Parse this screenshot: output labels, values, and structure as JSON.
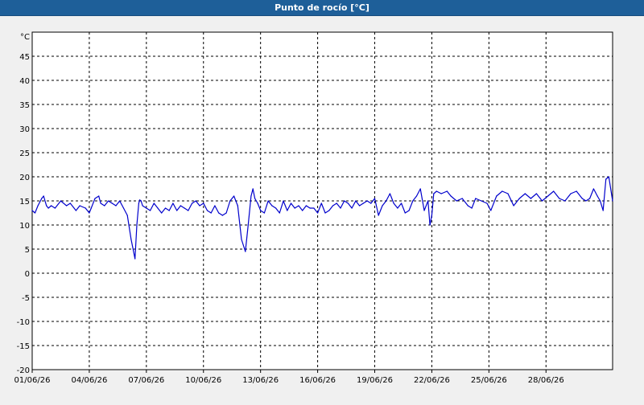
{
  "window": {
    "title": "Punto de rocío [°C]"
  },
  "colors": {
    "titlebar": "#1e5f99",
    "background": "#f0f0f0",
    "plot_background": "#ffffff",
    "series_line": "#0000cc",
    "grid": "#000000"
  },
  "chart_data": {
    "type": "line",
    "title": "Punto de rocío [°C]",
    "ylabel": "°C",
    "xlabel": "",
    "ylim": [
      -20,
      50
    ],
    "yticks": [
      -20,
      -15,
      -10,
      -5,
      0,
      5,
      10,
      15,
      20,
      25,
      30,
      35,
      40,
      45
    ],
    "xlim": [
      0,
      30.5
    ],
    "xticks": [
      {
        "day": 0,
        "label": "01/06/26"
      },
      {
        "day": 3,
        "label": "04/06/26"
      },
      {
        "day": 6,
        "label": "07/06/26"
      },
      {
        "day": 9,
        "label": "10/06/26"
      },
      {
        "day": 12,
        "label": "13/06/26"
      },
      {
        "day": 15,
        "label": "16/06/26"
      },
      {
        "day": 18,
        "label": "19/06/26"
      },
      {
        "day": 21,
        "label": "22/06/26"
      },
      {
        "day": 24,
        "label": "25/06/26"
      },
      {
        "day": 27,
        "label": "28/06/26"
      }
    ],
    "grid": true,
    "legend": "none",
    "series": [
      {
        "name": "",
        "x": [
          0.0,
          0.15,
          0.3,
          0.5,
          0.6,
          0.75,
          0.85,
          1.0,
          1.2,
          1.5,
          1.8,
          2.0,
          2.3,
          2.5,
          2.8,
          3.0,
          3.1,
          3.3,
          3.5,
          3.6,
          3.8,
          4.0,
          4.2,
          4.4,
          4.6,
          4.8,
          5.0,
          5.2,
          5.4,
          5.5,
          5.6,
          5.65,
          5.72,
          5.8,
          6.0,
          6.2,
          6.4,
          6.6,
          6.8,
          7.0,
          7.2,
          7.4,
          7.6,
          7.8,
          8.0,
          8.2,
          8.4,
          8.6,
          8.8,
          9.0,
          9.2,
          9.4,
          9.6,
          9.8,
          10.0,
          10.2,
          10.4,
          10.6,
          10.8,
          11.0,
          11.2,
          11.35,
          11.5,
          11.6,
          11.7,
          11.85,
          12.0,
          12.2,
          12.4,
          12.6,
          12.8,
          13.0,
          13.2,
          13.4,
          13.6,
          13.8,
          14.0,
          14.2,
          14.4,
          14.6,
          14.8,
          15.0,
          15.2,
          15.4,
          15.6,
          15.8,
          16.0,
          16.2,
          16.4,
          16.6,
          16.8,
          17.0,
          17.2,
          17.4,
          17.6,
          17.8,
          18.0,
          18.2,
          18.4,
          18.6,
          18.8,
          19.0,
          19.2,
          19.4,
          19.6,
          19.8,
          20.0,
          20.2,
          20.4,
          20.6,
          20.8,
          20.9,
          21.0,
          21.1,
          21.25,
          21.5,
          21.8,
          22.0,
          22.3,
          22.6,
          22.9,
          23.1,
          23.3,
          23.6,
          23.9,
          24.1,
          24.4,
          24.7,
          25.0,
          25.3,
          25.6,
          25.9,
          26.2,
          26.5,
          26.8,
          27.1,
          27.4,
          27.7,
          28.0,
          28.3
        ],
        "values": [
          13,
          12.5,
          14,
          15.5,
          16,
          14,
          13.5,
          14,
          13.5,
          15,
          14,
          14.5,
          13,
          14,
          13.5,
          12.5,
          13.5,
          15.5,
          16,
          14.5,
          14,
          15,
          14.5,
          14,
          15,
          13.5,
          12,
          7,
          3,
          10,
          14.5,
          15.2,
          15,
          14,
          13.5,
          13,
          14.5,
          13.5,
          12.5,
          13.5,
          13,
          14.5,
          13,
          14,
          13.5,
          13,
          14.5,
          15,
          14,
          14.5,
          13,
          12.5,
          14,
          12.5,
          12,
          12.5,
          15,
          16,
          14,
          7,
          4.5,
          10,
          16,
          17.5,
          15.5,
          14.5,
          13,
          12.5,
          15,
          14,
          13.5,
          12.5,
          15,
          13,
          14.5,
          13.5,
          14,
          13,
          14,
          13.5,
          13.5,
          12.5,
          14.5,
          12.5,
          13,
          14,
          14.5,
          13.5,
          15,
          14.5,
          13.5,
          15,
          14,
          14.5,
          15,
          14.5,
          15.5,
          12,
          14,
          15,
          16.5,
          14.5,
          13.5,
          14.5,
          12.5,
          13,
          15,
          16,
          17.5,
          13,
          15,
          10,
          12,
          16.5,
          17,
          16.5,
          17,
          16,
          15,
          15.5,
          14,
          13.5,
          15.5,
          15,
          14.5,
          13,
          16,
          17,
          16.5,
          14,
          15.5,
          16.5,
          15.5,
          16.5,
          15,
          16,
          17,
          15.5,
          15,
          16.5
        ]
      }
    ],
    "series_tail": {
      "x": [
        28.6,
        28.9,
        29.1,
        29.3,
        29.5,
        29.7,
        29.85,
        30.0,
        30.15,
        30.3,
        30.5
      ],
      "values": [
        17,
        15.5,
        15,
        15.5,
        17.5,
        16,
        15,
        13,
        19.5,
        20,
        15
      ]
    }
  }
}
